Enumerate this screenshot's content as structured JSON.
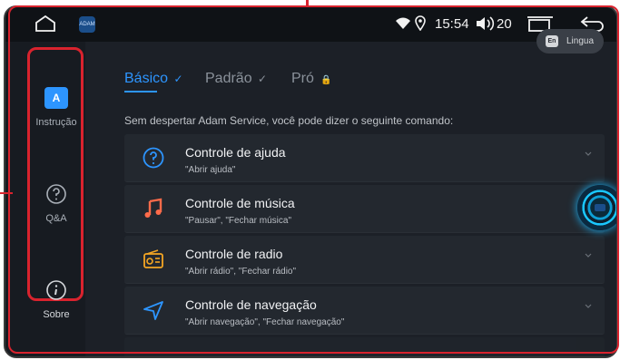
{
  "status": {
    "time": "15:54",
    "volume": "20"
  },
  "sidebar": {
    "items": [
      {
        "label": "Instrução",
        "badge": "A"
      },
      {
        "label": "Q&A"
      },
      {
        "label": "Sobre"
      }
    ]
  },
  "tabs": [
    {
      "label": "Básico"
    },
    {
      "label": "Padrão"
    },
    {
      "label": "Pró"
    }
  ],
  "language_button": {
    "badge": "En",
    "label": "Lingua"
  },
  "description": "Sem despertar Adam Service, você pode dizer o seguinte comando:",
  "commands": [
    {
      "title": "Controle de ajuda",
      "subtitle": "\"Abrir ajuda\"",
      "icon": "help-circle-icon",
      "color": "#2d95ff"
    },
    {
      "title": "Controle de música",
      "subtitle": "\"Pausar\", \"Fechar música\"",
      "icon": "music-note-icon",
      "color": "#ff6b4a"
    },
    {
      "title": "Controle de radio",
      "subtitle": "\"Abrir rádio\", \"Fechar rádio\"",
      "icon": "radio-icon",
      "color": "#f5a623"
    },
    {
      "title": "Controle de navegação",
      "subtitle": "\"Abrir navegação\", \"Fechar navegação\"",
      "icon": "navigation-arrow-icon",
      "color": "#2d95ff"
    }
  ]
}
